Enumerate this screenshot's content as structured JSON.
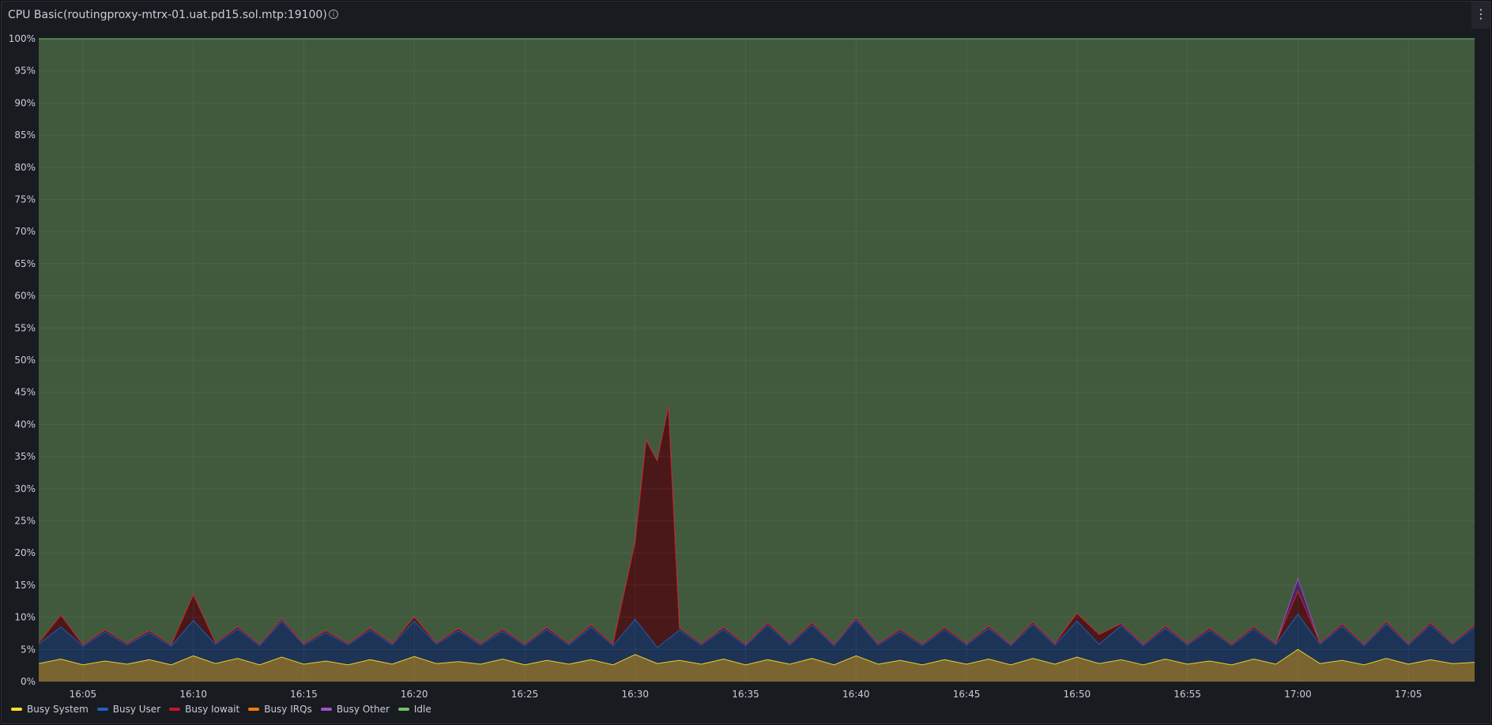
{
  "panel": {
    "title": "CPU Basic(routingproxy-mtrx-01.uat.pd15.sol.mtp:19100)",
    "info_icon": "info-circle-icon",
    "menu_icon": "kebab-menu-icon",
    "menu_glyph": "⋮"
  },
  "chart_data": {
    "type": "area",
    "stacked": true,
    "grid": true,
    "legend_position": "bottom-left",
    "ylim": [
      0,
      100
    ],
    "y_ticks": [
      "0%",
      "5%",
      "10%",
      "15%",
      "20%",
      "25%",
      "30%",
      "35%",
      "40%",
      "45%",
      "50%",
      "55%",
      "60%",
      "65%",
      "70%",
      "75%",
      "80%",
      "85%",
      "90%",
      "95%",
      "100%"
    ],
    "x_ticks": [
      "16:05",
      "16:10",
      "16:15",
      "16:20",
      "16:25",
      "16:30",
      "16:35",
      "16:40",
      "16:45",
      "16:50",
      "16:55",
      "17:00",
      "17:05"
    ],
    "x_range": [
      "16:03:00",
      "17:08:00"
    ],
    "series": [
      {
        "name": "Busy System",
        "color": "#fade2a",
        "fill": "#7a6430",
        "points": [
          [
            "16:03:00",
            2.8
          ],
          [
            "16:04:00",
            3.5
          ],
          [
            "16:05:00",
            2.6
          ],
          [
            "16:06:00",
            3.2
          ],
          [
            "16:07:00",
            2.7
          ],
          [
            "16:08:00",
            3.4
          ],
          [
            "16:09:00",
            2.6
          ],
          [
            "16:10:00",
            4.0
          ],
          [
            "16:11:00",
            2.8
          ],
          [
            "16:12:00",
            3.6
          ],
          [
            "16:13:00",
            2.6
          ],
          [
            "16:14:00",
            3.8
          ],
          [
            "16:15:00",
            2.7
          ],
          [
            "16:16:00",
            3.2
          ],
          [
            "16:17:00",
            2.6
          ],
          [
            "16:18:00",
            3.4
          ],
          [
            "16:19:00",
            2.7
          ],
          [
            "16:20:00",
            3.9
          ],
          [
            "16:21:00",
            2.8
          ],
          [
            "16:22:00",
            3.1
          ],
          [
            "16:23:00",
            2.7
          ],
          [
            "16:24:00",
            3.5
          ],
          [
            "16:25:00",
            2.6
          ],
          [
            "16:26:00",
            3.3
          ],
          [
            "16:27:00",
            2.7
          ],
          [
            "16:28:00",
            3.4
          ],
          [
            "16:29:00",
            2.6
          ],
          [
            "16:30:00",
            4.2
          ],
          [
            "16:31:00",
            2.8
          ],
          [
            "16:32:00",
            3.3
          ],
          [
            "16:33:00",
            2.7
          ],
          [
            "16:34:00",
            3.5
          ],
          [
            "16:35:00",
            2.6
          ],
          [
            "16:36:00",
            3.4
          ],
          [
            "16:37:00",
            2.7
          ],
          [
            "16:38:00",
            3.6
          ],
          [
            "16:39:00",
            2.6
          ],
          [
            "16:40:00",
            4.0
          ],
          [
            "16:41:00",
            2.7
          ],
          [
            "16:42:00",
            3.3
          ],
          [
            "16:43:00",
            2.6
          ],
          [
            "16:44:00",
            3.4
          ],
          [
            "16:45:00",
            2.7
          ],
          [
            "16:46:00",
            3.5
          ],
          [
            "16:47:00",
            2.6
          ],
          [
            "16:48:00",
            3.6
          ],
          [
            "16:49:00",
            2.7
          ],
          [
            "16:50:00",
            3.8
          ],
          [
            "16:51:00",
            2.8
          ],
          [
            "16:52:00",
            3.4
          ],
          [
            "16:53:00",
            2.6
          ],
          [
            "16:54:00",
            3.5
          ],
          [
            "16:55:00",
            2.7
          ],
          [
            "16:56:00",
            3.2
          ],
          [
            "16:57:00",
            2.6
          ],
          [
            "16:58:00",
            3.5
          ],
          [
            "16:59:00",
            2.7
          ],
          [
            "17:00:00",
            5.0
          ],
          [
            "17:01:00",
            2.8
          ],
          [
            "17:02:00",
            3.3
          ],
          [
            "17:03:00",
            2.6
          ],
          [
            "17:04:00",
            3.6
          ],
          [
            "17:05:00",
            2.7
          ],
          [
            "17:06:00",
            3.4
          ],
          [
            "17:07:00",
            2.8
          ],
          [
            "17:08:00",
            3.0
          ]
        ]
      },
      {
        "name": "Busy User",
        "color": "#1f60c4",
        "fill": "#1d3456",
        "points": [
          [
            "16:03:00",
            3.0
          ],
          [
            "16:04:00",
            5.0
          ],
          [
            "16:05:00",
            2.9
          ],
          [
            "16:06:00",
            4.5
          ],
          [
            "16:07:00",
            3.0
          ],
          [
            "16:08:00",
            4.2
          ],
          [
            "16:09:00",
            2.9
          ],
          [
            "16:10:00",
            5.5
          ],
          [
            "16:11:00",
            3.0
          ],
          [
            "16:12:00",
            4.6
          ],
          [
            "16:13:00",
            3.0
          ],
          [
            "16:14:00",
            5.6
          ],
          [
            "16:15:00",
            3.0
          ],
          [
            "16:16:00",
            4.4
          ],
          [
            "16:17:00",
            3.1
          ],
          [
            "16:18:00",
            4.6
          ],
          [
            "16:19:00",
            3.0
          ],
          [
            "16:20:00",
            5.5
          ],
          [
            "16:21:00",
            3.0
          ],
          [
            "16:22:00",
            4.8
          ],
          [
            "16:23:00",
            3.0
          ],
          [
            "16:24:00",
            4.3
          ],
          [
            "16:25:00",
            3.0
          ],
          [
            "16:26:00",
            4.8
          ],
          [
            "16:27:00",
            3.0
          ],
          [
            "16:28:00",
            5.1
          ],
          [
            "16:29:00",
            3.0
          ],
          [
            "16:30:00",
            5.5
          ],
          [
            "16:31:00",
            2.5
          ],
          [
            "16:32:00",
            4.7
          ],
          [
            "16:33:00",
            3.0
          ],
          [
            "16:34:00",
            4.6
          ],
          [
            "16:35:00",
            3.0
          ],
          [
            "16:36:00",
            5.4
          ],
          [
            "16:37:00",
            3.0
          ],
          [
            "16:38:00",
            5.2
          ],
          [
            "16:39:00",
            3.0
          ],
          [
            "16:40:00",
            5.6
          ],
          [
            "16:41:00",
            3.0
          ],
          [
            "16:42:00",
            4.5
          ],
          [
            "16:43:00",
            3.0
          ],
          [
            "16:44:00",
            4.7
          ],
          [
            "16:45:00",
            3.0
          ],
          [
            "16:46:00",
            4.8
          ],
          [
            "16:47:00",
            3.0
          ],
          [
            "16:48:00",
            5.3
          ],
          [
            "16:49:00",
            3.0
          ],
          [
            "16:50:00",
            5.6
          ],
          [
            "16:51:00",
            3.0
          ],
          [
            "16:52:00",
            5.3
          ],
          [
            "16:53:00",
            3.0
          ],
          [
            "16:54:00",
            4.8
          ],
          [
            "16:55:00",
            3.0
          ],
          [
            "16:56:00",
            4.8
          ],
          [
            "16:57:00",
            3.0
          ],
          [
            "16:58:00",
            4.7
          ],
          [
            "16:59:00",
            3.0
          ],
          [
            "17:00:00",
            5.5
          ],
          [
            "17:01:00",
            3.0
          ],
          [
            "17:02:00",
            5.3
          ],
          [
            "17:03:00",
            3.0
          ],
          [
            "17:04:00",
            5.4
          ],
          [
            "17:05:00",
            3.0
          ],
          [
            "17:06:00",
            5.4
          ],
          [
            "17:07:00",
            3.0
          ],
          [
            "17:08:00",
            5.5
          ]
        ]
      },
      {
        "name": "Busy Iowait",
        "color": "#c4162a",
        "fill": "#4a1818",
        "points": [
          [
            "16:03:00",
            0.2
          ],
          [
            "16:04:00",
            1.8
          ],
          [
            "16:05:00",
            0.2
          ],
          [
            "16:06:00",
            0.3
          ],
          [
            "16:07:00",
            0.2
          ],
          [
            "16:08:00",
            0.3
          ],
          [
            "16:09:00",
            0.2
          ],
          [
            "16:10:00",
            4.0
          ],
          [
            "16:11:00",
            0.2
          ],
          [
            "16:12:00",
            0.3
          ],
          [
            "16:13:00",
            0.2
          ],
          [
            "16:14:00",
            0.3
          ],
          [
            "16:15:00",
            0.2
          ],
          [
            "16:16:00",
            0.3
          ],
          [
            "16:17:00",
            0.2
          ],
          [
            "16:18:00",
            0.3
          ],
          [
            "16:19:00",
            0.2
          ],
          [
            "16:20:00",
            0.6
          ],
          [
            "16:21:00",
            0.2
          ],
          [
            "16:22:00",
            0.3
          ],
          [
            "16:23:00",
            0.2
          ],
          [
            "16:24:00",
            0.3
          ],
          [
            "16:25:00",
            0.2
          ],
          [
            "16:26:00",
            0.3
          ],
          [
            "16:27:00",
            0.2
          ],
          [
            "16:28:00",
            0.3
          ],
          [
            "16:29:00",
            0.2
          ],
          [
            "16:30:00",
            12.0
          ],
          [
            "16:30:30",
            30.0
          ],
          [
            "16:31:00",
            29.0
          ],
          [
            "16:31:30",
            36.0
          ],
          [
            "16:32:00",
            0.3
          ],
          [
            "16:33:00",
            0.2
          ],
          [
            "16:34:00",
            0.3
          ],
          [
            "16:35:00",
            0.2
          ],
          [
            "16:36:00",
            0.3
          ],
          [
            "16:37:00",
            0.2
          ],
          [
            "16:38:00",
            0.3
          ],
          [
            "16:39:00",
            0.2
          ],
          [
            "16:40:00",
            0.3
          ],
          [
            "16:41:00",
            0.2
          ],
          [
            "16:42:00",
            0.3
          ],
          [
            "16:43:00",
            0.2
          ],
          [
            "16:44:00",
            0.3
          ],
          [
            "16:45:00",
            0.2
          ],
          [
            "16:46:00",
            0.3
          ],
          [
            "16:47:00",
            0.2
          ],
          [
            "16:48:00",
            0.3
          ],
          [
            "16:49:00",
            0.2
          ],
          [
            "16:50:00",
            1.2
          ],
          [
            "16:51:00",
            1.5
          ],
          [
            "16:52:00",
            0.3
          ],
          [
            "16:53:00",
            0.2
          ],
          [
            "16:54:00",
            0.3
          ],
          [
            "16:55:00",
            0.2
          ],
          [
            "16:56:00",
            0.3
          ],
          [
            "16:57:00",
            0.2
          ],
          [
            "16:58:00",
            0.3
          ],
          [
            "16:59:00",
            0.2
          ],
          [
            "17:00:00",
            3.5
          ],
          [
            "17:01:00",
            0.2
          ],
          [
            "17:02:00",
            0.3
          ],
          [
            "17:03:00",
            0.2
          ],
          [
            "17:04:00",
            0.3
          ],
          [
            "17:05:00",
            0.2
          ],
          [
            "17:06:00",
            0.3
          ],
          [
            "17:07:00",
            0.2
          ],
          [
            "17:08:00",
            0.3
          ]
        ]
      },
      {
        "name": "Busy IRQs",
        "color": "#ff780a",
        "fill": "#7a3d10",
        "points": [
          [
            "16:03:00",
            0.0
          ],
          [
            "17:08:00",
            0.0
          ]
        ]
      },
      {
        "name": "Busy Other",
        "color": "#a352cc",
        "fill": "#4a2560",
        "points": [
          [
            "16:03:00",
            0.0
          ],
          [
            "16:59:00",
            0.0
          ],
          [
            "17:00:00",
            2.0
          ],
          [
            "17:01:00",
            0.0
          ],
          [
            "17:08:00",
            0.0
          ]
        ]
      },
      {
        "name": "Idle",
        "color": "#73bf69",
        "fill": "#415a3e",
        "fill_to_top": true,
        "points": []
      }
    ]
  }
}
